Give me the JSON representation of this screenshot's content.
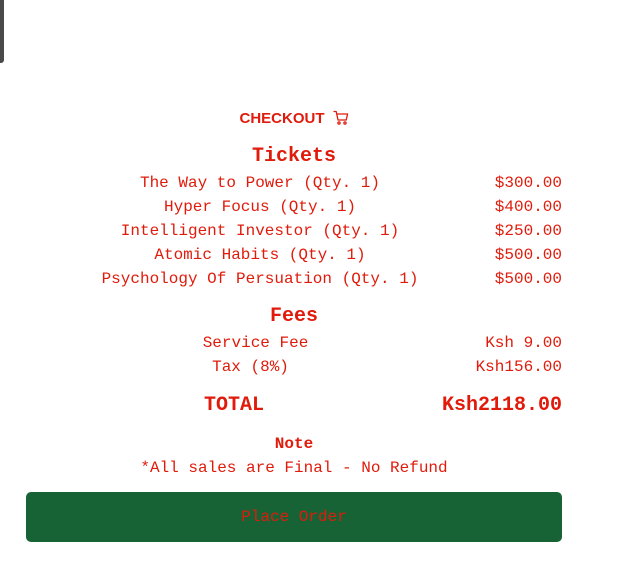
{
  "checkout": {
    "title": "CHECKOUT",
    "icon": "cart-icon"
  },
  "tickets": {
    "title": "Tickets",
    "items": [
      {
        "name": "The Way to Power (Qty. 1)",
        "price": "$300.00"
      },
      {
        "name": "Hyper Focus (Qty. 1)",
        "price": "$400.00"
      },
      {
        "name": "Intelligent Investor (Qty. 1)",
        "price": "$250.00"
      },
      {
        "name": "Atomic Habits (Qty. 1)",
        "price": "$500.00"
      },
      {
        "name": "Psychology Of Persuation (Qty. 1)",
        "price": "$500.00"
      }
    ]
  },
  "fees": {
    "title": "Fees",
    "items": [
      {
        "name": "Service Fee",
        "price": "Ksh 9.00"
      },
      {
        "name": "Tax (8%)",
        "price": "Ksh156.00"
      }
    ]
  },
  "total": {
    "label": "TOTAL",
    "amount": "Ksh2118.00"
  },
  "note": {
    "title": "Note",
    "text": "*All sales are Final - No Refund"
  },
  "actions": {
    "place_order": "Place Order"
  },
  "colors": {
    "text": "#e01b0b",
    "button_bg": "#176335",
    "corner_tab": "#4a4a4a"
  }
}
